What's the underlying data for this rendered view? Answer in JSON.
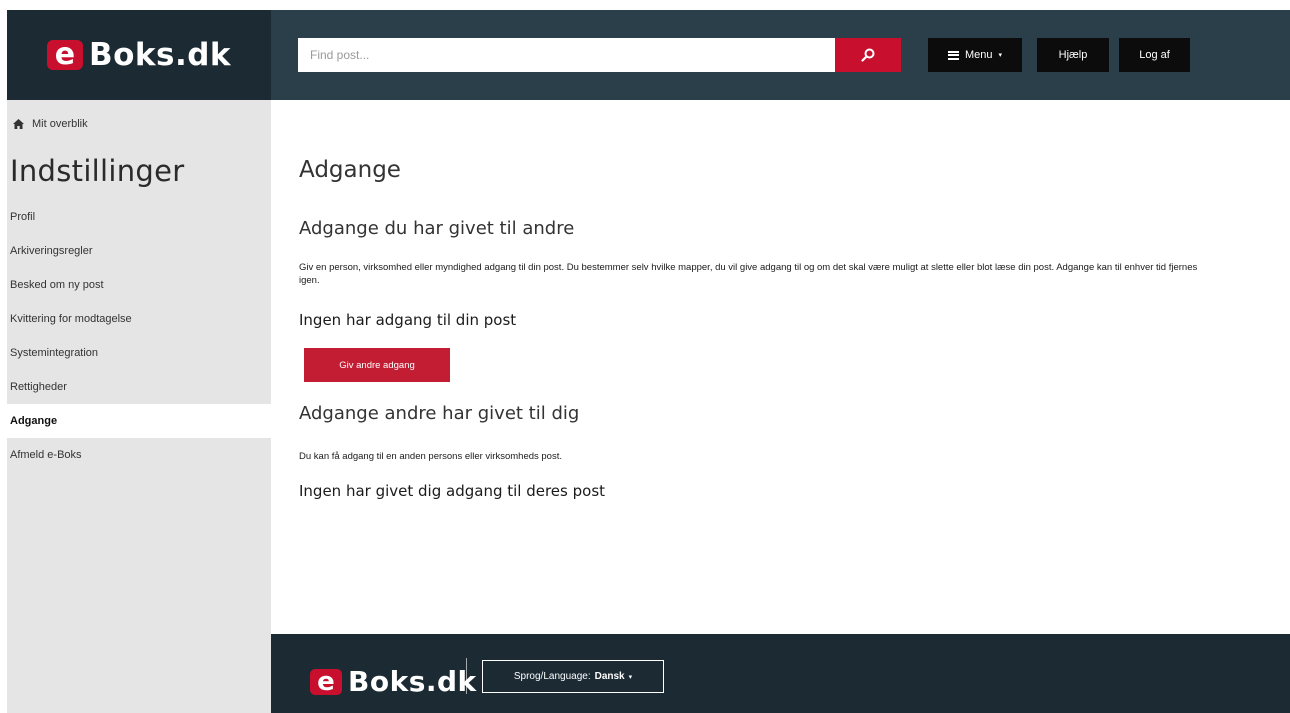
{
  "brand": {
    "logo_letter": "e",
    "logo_text": "Boks.dk"
  },
  "header": {
    "search_placeholder": "Find post...",
    "menu_label": "Menu",
    "help_label": "Hjælp",
    "logout_label": "Log af"
  },
  "sidebar": {
    "overview_label": "Mit overblik",
    "title": "Indstillinger",
    "items": [
      {
        "label": "Profil",
        "active": false
      },
      {
        "label": "Arkiveringsregler",
        "active": false
      },
      {
        "label": "Besked om ny post",
        "active": false
      },
      {
        "label": "Kvittering for modtagelse",
        "active": false
      },
      {
        "label": "Systemintegration",
        "active": false
      },
      {
        "label": "Rettigheder",
        "active": false
      },
      {
        "label": "Adgange",
        "active": true
      },
      {
        "label": "Afmeld e-Boks",
        "active": false
      }
    ]
  },
  "main": {
    "title": "Adgange",
    "given": {
      "heading": "Adgange du har givet til andre",
      "description": "Giv en person, virksomhed eller myndighed adgang til din post. Du bestemmer selv hvilke mapper, du vil give adgang til og om det skal være muligt at slette eller blot læse din post. Adgange kan til enhver tid fjernes igen.",
      "status": "Ingen har adgang til din post",
      "button_label": "Giv andre adgang"
    },
    "received": {
      "heading": "Adgange andre har givet til dig",
      "description": "Du kan få adgang til en anden persons eller virksomheds post.",
      "status": "Ingen har givet dig adgang til deres post"
    }
  },
  "footer": {
    "language_label": "Sprog/Language:",
    "language_value": "Dansk"
  },
  "colors": {
    "brand_red": "#c8102e",
    "header_bg": "#2b3f4a",
    "dark_bg": "#1b2a33",
    "sidebar_bg": "#e5e5e5"
  }
}
